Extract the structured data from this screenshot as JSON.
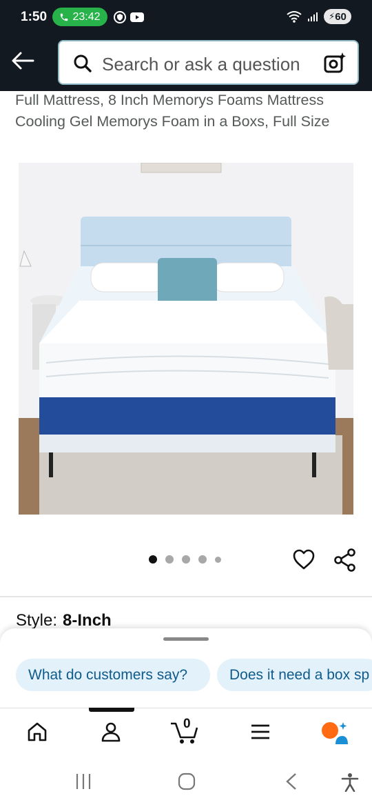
{
  "status_bar": {
    "time": "1:50",
    "call_timer": "23:42",
    "battery": "60"
  },
  "search": {
    "placeholder": "Search or ask a question"
  },
  "product": {
    "title": "Full Mattress, 8 Inch Memorys Foams Mattress Cooling Gel Memorys Foam in a Boxs, Full Size",
    "image_count": 5,
    "active_image": 1
  },
  "style": {
    "label": "Style:",
    "value": "8-Inch"
  },
  "suggestions": [
    {
      "label": "What do customers say?"
    },
    {
      "label": "Does it need a box sp"
    }
  ],
  "bottom_nav": {
    "cart_count": "0",
    "items": [
      "home-icon",
      "account-icon",
      "cart-icon",
      "menu-icon",
      "rufus-icon"
    ]
  },
  "colors": {
    "header_bg": "#131921",
    "chip_bg": "#e3f1fa",
    "chip_text": "#0f5b8c",
    "call_green": "#27b24a"
  }
}
